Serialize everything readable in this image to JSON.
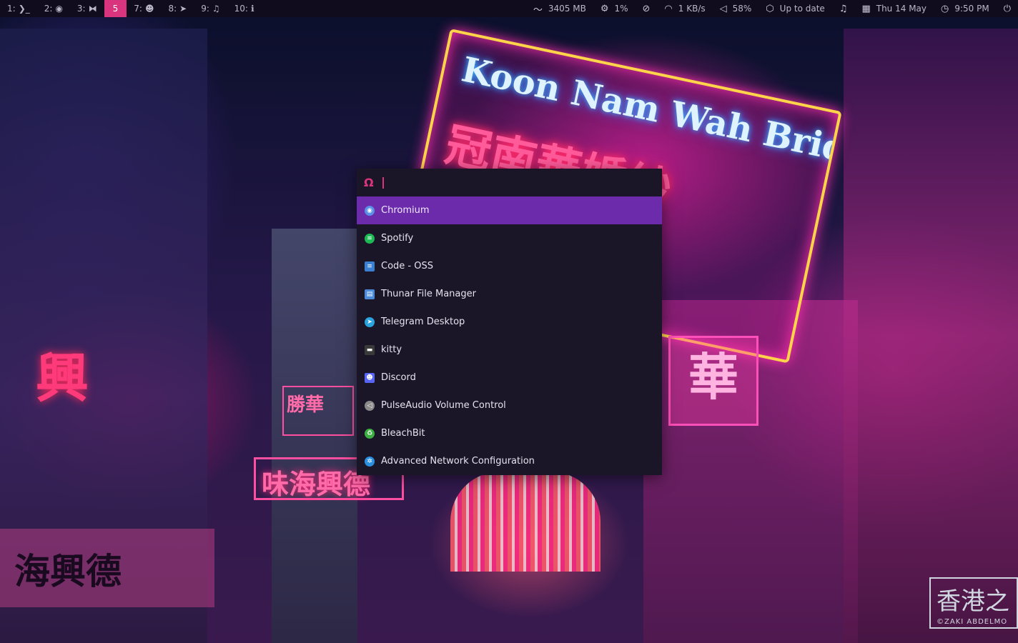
{
  "topbar": {
    "workspaces": [
      {
        "label": "1:",
        "icon": "terminal-icon",
        "glyph": "❯_",
        "active": false
      },
      {
        "label": "2:",
        "icon": "chromium-icon",
        "glyph": "◉",
        "active": false
      },
      {
        "label": "3:",
        "icon": "vscode-icon",
        "glyph": "⧓",
        "active": false
      },
      {
        "label": "5",
        "icon": "",
        "glyph": "",
        "active": true
      },
      {
        "label": "7:",
        "icon": "discord-icon",
        "glyph": "☻",
        "active": false
      },
      {
        "label": "8:",
        "icon": "telegram-icon",
        "glyph": "➤",
        "active": false
      },
      {
        "label": "9:",
        "icon": "music-icon",
        "glyph": "♫",
        "active": false
      },
      {
        "label": "10:",
        "icon": "info-icon",
        "glyph": "ℹ",
        "active": false
      }
    ],
    "status": {
      "memory": "3405 MB",
      "cpu": "1%",
      "network_speed": "1 KB/s",
      "volume": "58%",
      "updates": "Up to date",
      "date": "Thu 14 May",
      "time": "9:50 PM"
    }
  },
  "launcher": {
    "prompt_glyph": "Ω",
    "query": "",
    "selected_index": 0,
    "entries": [
      {
        "label": "Chromium",
        "icon": "chromium-icon",
        "color": "#5b8fe6"
      },
      {
        "label": "Spotify",
        "icon": "spotify-icon",
        "color": "#1db954"
      },
      {
        "label": "Code - OSS",
        "icon": "code-oss-icon",
        "color": "#3a7fd0"
      },
      {
        "label": "Thunar File Manager",
        "icon": "thunar-icon",
        "color": "#4a8ad8"
      },
      {
        "label": "Telegram Desktop",
        "icon": "telegram-icon",
        "color": "#2aa3df"
      },
      {
        "label": "kitty",
        "icon": "kitty-icon",
        "color": "#3a3a3a"
      },
      {
        "label": "Discord",
        "icon": "discord-icon",
        "color": "#5865f2"
      },
      {
        "label": "PulseAudio Volume Control",
        "icon": "pulseaudio-icon",
        "color": "#8a8a8a"
      },
      {
        "label": "BleachBit",
        "icon": "bleachbit-icon",
        "color": "#3cb043"
      },
      {
        "label": "Advanced Network Configuration",
        "icon": "network-config-icon",
        "color": "#2b8fe0"
      }
    ]
  },
  "wallpaper": {
    "sign_main_en": "Koon Nam Wah Bridal",
    "sign_main_cn": "冠南華婚紗",
    "sign_left": "興",
    "sign_mid": "味海興德",
    "sign_small": "勝華",
    "sign_right": "華",
    "sign_bottom_left": "海興德",
    "watermark": "香港之",
    "watermark_credit": "©ZAKI ABDELMO"
  },
  "colors": {
    "accent": "#d9347e",
    "selection": "#6c2bab",
    "launcher_bg": "#1b1528",
    "bar_bg": "#100c1e"
  }
}
